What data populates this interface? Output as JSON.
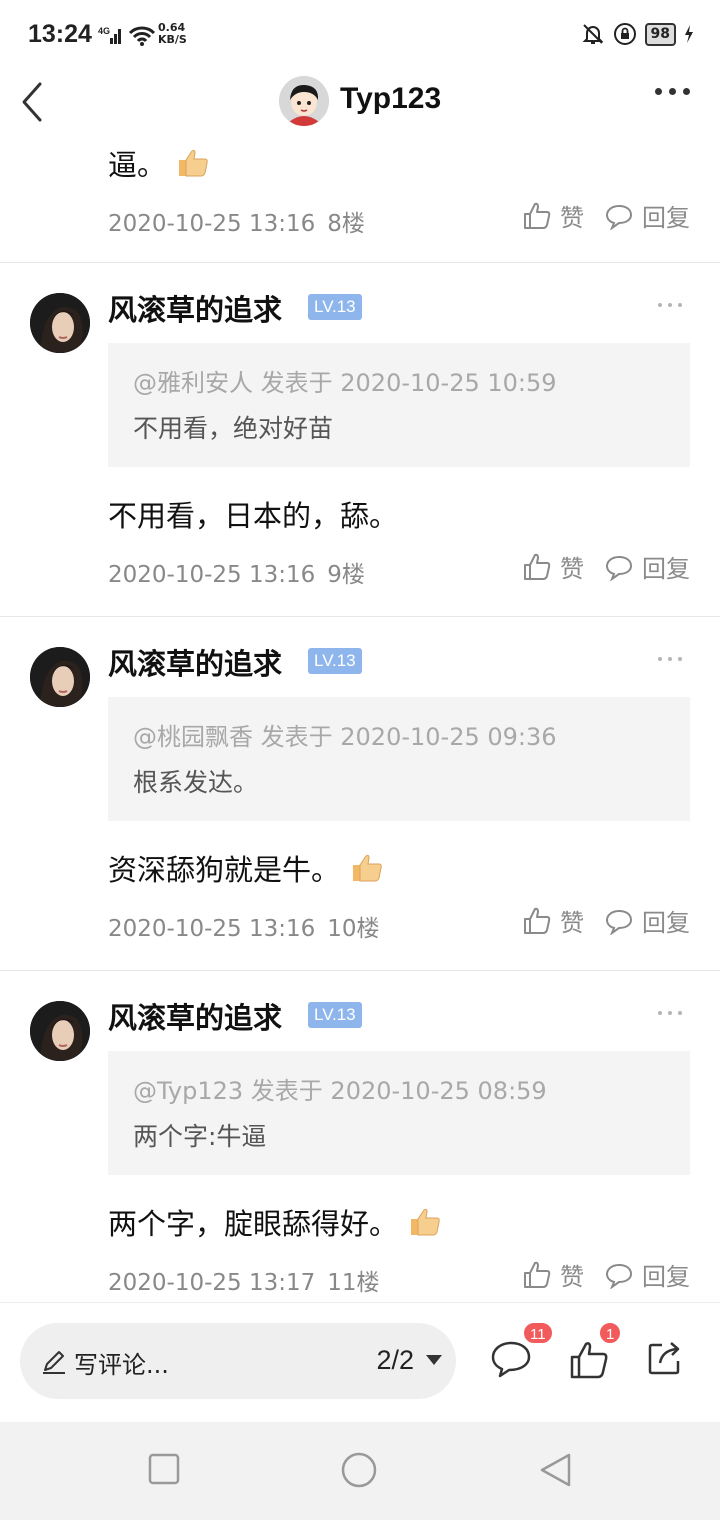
{
  "status_bar": {
    "time": "13:24",
    "network": "4G",
    "speed_value": "0.64",
    "speed_unit": "KB/S",
    "battery": "98"
  },
  "header": {
    "title": "Typ123"
  },
  "comments": [
    {
      "text": "逼。",
      "has_thumb": true,
      "timestamp": "2020-10-25 13:16",
      "floor": "8楼",
      "like_label": "赞",
      "reply_label": "回复"
    },
    {
      "username": "风滚草的追求",
      "level": "LV.13",
      "quote": {
        "meta": "@雅利安人 发表于 2020-10-25 10:59",
        "text": "不用看，绝对好苗"
      },
      "text": "不用看，日本的，舔。",
      "timestamp": "2020-10-25 13:16",
      "floor": "9楼",
      "like_label": "赞",
      "reply_label": "回复"
    },
    {
      "username": "风滚草的追求",
      "level": "LV.13",
      "quote": {
        "meta": "@桃园飘香 发表于 2020-10-25 09:36",
        "text": "根系发达。"
      },
      "text": "资深舔狗就是牛。",
      "timestamp": "2020-10-25 13:16",
      "floor": "10楼",
      "like_label": "赞",
      "reply_label": "回复"
    },
    {
      "username": "风滚草的追求",
      "level": "LV.13",
      "quote": {
        "meta": "@Typ123 发表于 2020-10-25 08:59",
        "text": "两个字:牛逼"
      },
      "text": "两个字，腚眼舔得好。",
      "timestamp": "2020-10-25 13:17",
      "floor": "11楼",
      "like_label": "赞",
      "reply_label": "回复"
    }
  ],
  "bottom_bar": {
    "write_placeholder": "写评论...",
    "page": "2/2",
    "comment_count": "11",
    "like_count": "1"
  },
  "colors": {
    "level_badge": "#8fb6ec",
    "count_badge": "#f25b5b",
    "quote_bg": "#f4f4f4"
  }
}
